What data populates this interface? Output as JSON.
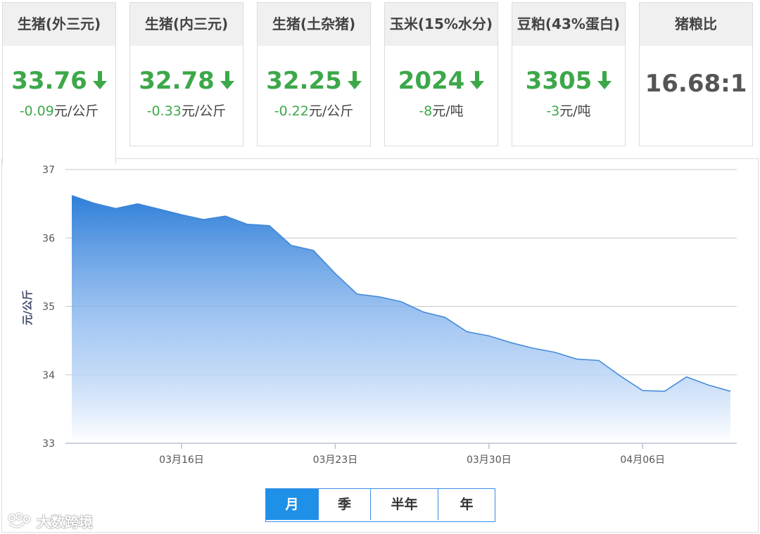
{
  "cards": [
    {
      "title": "生猪(外三元)",
      "value": "33.76",
      "delta": "-0.09",
      "unit": "元/公斤",
      "trend": "down",
      "active": true
    },
    {
      "title": "生猪(内三元)",
      "value": "32.78",
      "delta": "-0.33",
      "unit": "元/公斤",
      "trend": "down",
      "active": false
    },
    {
      "title": "生猪(土杂猪)",
      "value": "32.25",
      "delta": "-0.22",
      "unit": "元/公斤",
      "trend": "down",
      "active": false
    },
    {
      "title": "玉米(15%水分)",
      "value": "2024",
      "delta": "-8",
      "unit": "元/吨",
      "trend": "down",
      "active": false
    },
    {
      "title": "豆粕(43%蛋白)",
      "value": "3305",
      "delta": "-3",
      "unit": "元/吨",
      "trend": "down",
      "active": false
    },
    {
      "title": "猪粮比",
      "value": "16.68:1",
      "delta": "",
      "unit": "",
      "trend": "none",
      "active": false
    }
  ],
  "colors": {
    "down": "#3da84a",
    "area_top": "#2f7fd8",
    "area_bottom": "#ffffff",
    "line": "#3f86d6",
    "grid": "#c8c8c8",
    "active_button": "#1e90e8"
  },
  "chart_data": {
    "type": "area",
    "ylabel": "元/公斤",
    "ylim": [
      33,
      37
    ],
    "yticks": [
      33,
      34,
      35,
      36,
      37
    ],
    "xticks": [
      {
        "label": "03月16日",
        "x": "2021-03-16"
      },
      {
        "label": "03月23日",
        "x": "2021-03-23"
      },
      {
        "label": "03月30日",
        "x": "2021-03-30"
      },
      {
        "label": "04月06日",
        "x": "2021-04-06"
      }
    ],
    "x": [
      "2021-03-11",
      "2021-03-12",
      "2021-03-13",
      "2021-03-14",
      "2021-03-15",
      "2021-03-16",
      "2021-03-17",
      "2021-03-18",
      "2021-03-19",
      "2021-03-20",
      "2021-03-21",
      "2021-03-22",
      "2021-03-23",
      "2021-03-24",
      "2021-03-25",
      "2021-03-26",
      "2021-03-27",
      "2021-03-28",
      "2021-03-29",
      "2021-03-30",
      "2021-03-31",
      "2021-04-01",
      "2021-04-02",
      "2021-04-03",
      "2021-04-04",
      "2021-04-05",
      "2021-04-06",
      "2021-04-07",
      "2021-04-08",
      "2021-04-09",
      "2021-04-10"
    ],
    "values": [
      36.62,
      36.51,
      36.43,
      36.5,
      36.42,
      36.34,
      36.27,
      36.32,
      36.2,
      36.18,
      35.89,
      35.82,
      35.48,
      35.18,
      35.14,
      35.07,
      34.92,
      34.84,
      34.63,
      34.57,
      34.47,
      34.39,
      34.33,
      34.23,
      34.21,
      33.98,
      33.77,
      33.76,
      33.97,
      33.85,
      33.76
    ],
    "grid": true,
    "legend": "none"
  },
  "range_buttons": [
    {
      "label": "月",
      "active": true
    },
    {
      "label": "季",
      "active": false
    },
    {
      "label": "半年",
      "active": false
    },
    {
      "label": "年",
      "active": false
    }
  ],
  "watermark": {
    "text": "大数跨境",
    "icon": "bear-logo-icon"
  }
}
